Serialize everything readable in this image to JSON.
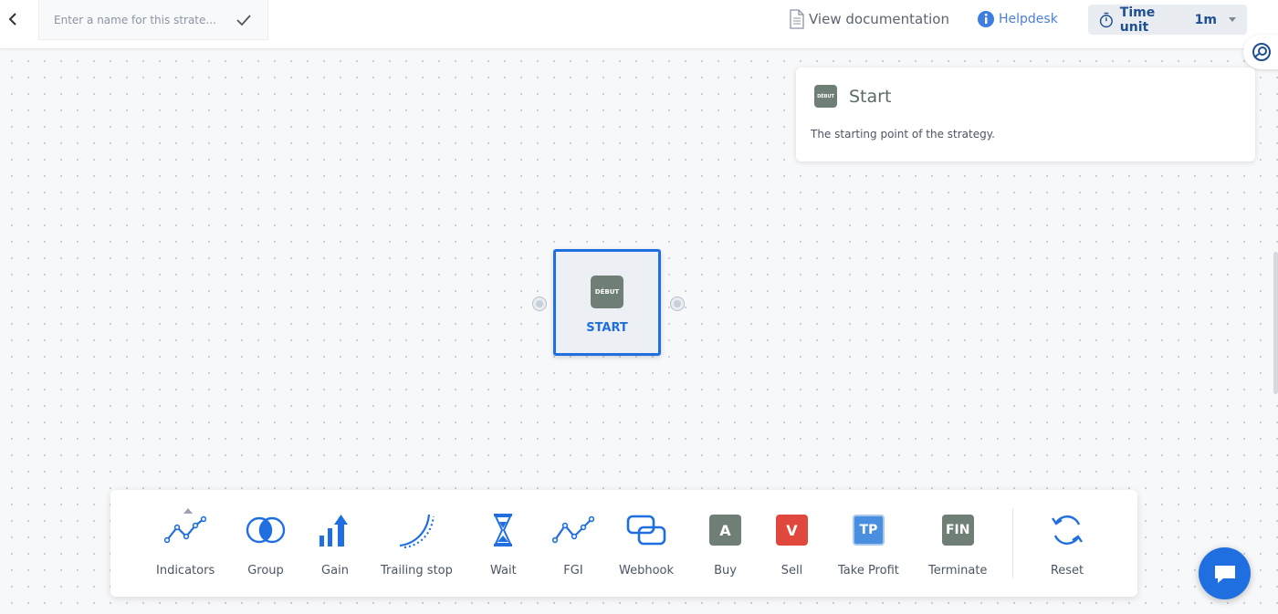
{
  "header": {
    "strategy_name_value": "",
    "strategy_name_placeholder": "Enter a name for this strate...",
    "view_documentation": "View documentation",
    "helpdesk": "Helpdesk",
    "time_unit_label": "Time unit",
    "time_unit_value": "1m"
  },
  "info_card": {
    "badge_text": "DÉBUT",
    "title": "Start",
    "description": "The starting point of the strategy."
  },
  "node": {
    "badge_text": "DÉBUT",
    "label": "START"
  },
  "toolbar": {
    "items": [
      {
        "label": "Indicators",
        "icon": "indicators-icon"
      },
      {
        "label": "Group",
        "icon": "group-icon"
      },
      {
        "label": "Gain",
        "icon": "gain-icon"
      },
      {
        "label": "Trailing stop",
        "icon": "trailing-stop-icon"
      },
      {
        "label": "Wait",
        "icon": "hourglass-icon"
      },
      {
        "label": "FGI",
        "icon": "fgi-icon"
      },
      {
        "label": "Webhook",
        "icon": "webhook-icon"
      },
      {
        "label": "Buy",
        "icon": "buy-icon",
        "badge": "A",
        "color": "#6f7f76"
      },
      {
        "label": "Sell",
        "icon": "sell-icon",
        "badge": "V",
        "color": "#e0483e"
      },
      {
        "label": "Take Profit",
        "icon": "take-profit-icon",
        "badge": "TP",
        "color": "#4a8ee0"
      },
      {
        "label": "Terminate",
        "icon": "terminate-icon",
        "badge": "FIN",
        "color": "#6f7f76"
      }
    ],
    "reset_label": "Reset"
  },
  "colors": {
    "accent": "#1f6fe0",
    "brand_dark": "#1d4f91",
    "badge_green": "#6f7f76"
  }
}
